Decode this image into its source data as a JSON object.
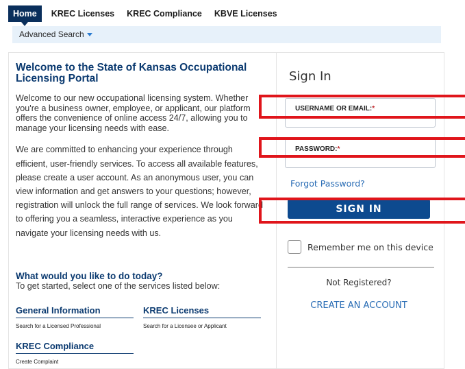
{
  "nav": {
    "tabs": [
      "Home",
      "KREC Licenses",
      "KREC Compliance",
      "KBVE Licenses"
    ],
    "active_tab": "Home",
    "advanced_search": "Advanced Search"
  },
  "welcome": {
    "title": "Welcome to the State of Kansas Occupational Licensing Portal",
    "intro": "Welcome to our new occupational licensing system. Whether you're a business owner, employee, or applicant, our platform offers the convenience of online access 24/7, allowing you to manage your licensing needs with ease.",
    "body": "We are committed to enhancing your experience through efficient, user-friendly services. To access all available features, please create a user account. As an anonymous user, you can view information and get answers to your questions; however, registration will unlock the full range of services. We look forward to offering you a seamless, interactive experience as you navigate your licensing needs with us."
  },
  "services": {
    "heading": "What would you like to do today?",
    "subheading": "To get started, select one of the services listed below:",
    "items": [
      {
        "title": "General Information",
        "desc": "Search for a Licensed Professional"
      },
      {
        "title": "KREC Licenses",
        "desc": "Search for a Licensee or Applicant"
      },
      {
        "title": "KREC Compliance",
        "desc": "Create Complaint"
      }
    ]
  },
  "signin": {
    "title": "Sign In",
    "username_label": "USERNAME OR EMAIL:",
    "password_label": "PASSWORD:",
    "required_mark": "*",
    "forgot": "Forgot Password?",
    "button": "SIGN IN",
    "remember": "Remember me on this device",
    "not_registered": "Not Registered?",
    "create_account": "CREATE AN ACCOUNT"
  },
  "colors": {
    "brand_navy": "#0b3a70",
    "button_blue": "#0d4a8f",
    "link_blue": "#2a6db5",
    "annotation_red": "#e0151b"
  }
}
